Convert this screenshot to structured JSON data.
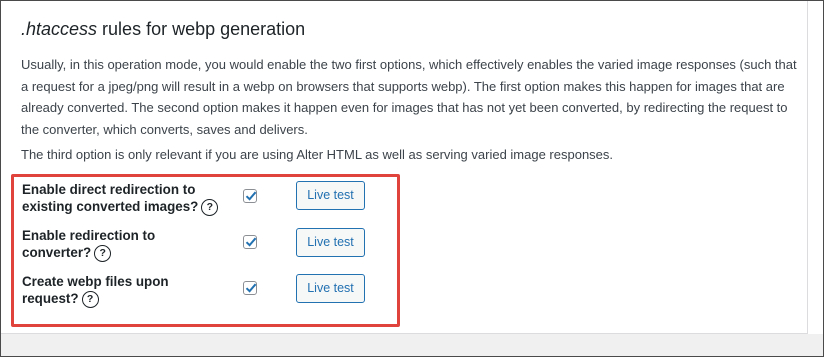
{
  "title": {
    "italic": ".htaccess",
    "rest": " rules for webp generation"
  },
  "description": "Usually, in this operation mode, you would enable the two first options, which effectively enables the varied image responses (such that a request for a jpeg/png will result in a webp on browsers that supports webp). The first option makes this happen for images that are already converted. The second option makes it happen even for images that has not yet been converted, by redirecting the request to the converter, which converts, saves and delivers.",
  "note": "The third option is only relevant if you are using Alter HTML as well as serving varied image responses.",
  "help_symbol": "?",
  "options": [
    {
      "label": "Enable direct redirection to existing converted images?",
      "checked": true,
      "button": "Live test"
    },
    {
      "label": "Enable redirection to converter?",
      "checked": true,
      "button": "Live test"
    },
    {
      "label": "Create webp files upon request?",
      "checked": true,
      "button": "Live test"
    }
  ],
  "colors": {
    "highlight_border": "#e0433b",
    "button_accent": "#2271b1",
    "checkmark": "#2271b1"
  }
}
